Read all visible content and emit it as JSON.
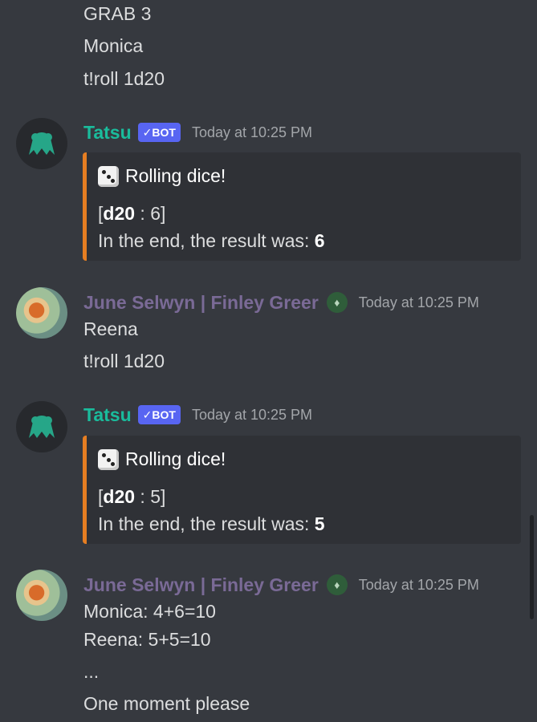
{
  "colors": {
    "background": "#36393f",
    "bot_name": "#1abc9c",
    "user_name": "#7a6a96",
    "bot_tag": "#5865f2",
    "embed_bar": "#e67e22",
    "embed_bg": "#2f3136"
  },
  "previous_lines": [
    "GRAB 3",
    "Monica",
    "t!roll 1d20"
  ],
  "bot_msg_1": {
    "author": "Tatsu",
    "tag": "✓BOT",
    "timestamp": "Today at 10:25 PM",
    "embed": {
      "icon": "dice-icon",
      "title": "Rolling dice!",
      "roll_open": "[",
      "roll_die": "d20",
      "roll_rest": " : 6]",
      "result_prefix": "In the end, the result was: ",
      "result_value": "6"
    }
  },
  "user_msg_1": {
    "author": "June Selwyn | Finley Greer",
    "badge": "slytherin-badge-icon",
    "timestamp": "Today at 10:25 PM",
    "lines": [
      "Reena",
      "t!roll 1d20"
    ]
  },
  "bot_msg_2": {
    "author": "Tatsu",
    "tag": "✓BOT",
    "timestamp": "Today at 10:25 PM",
    "embed": {
      "icon": "dice-icon",
      "title": "Rolling dice!",
      "roll_open": "[",
      "roll_die": "d20",
      "roll_rest": " : 5]",
      "result_prefix": "In the end, the result was: ",
      "result_value": "5"
    }
  },
  "user_msg_2": {
    "author": "June Selwyn | Finley Greer",
    "badge": "slytherin-badge-icon",
    "timestamp": "Today at 10:25 PM",
    "lines": [
      "Monica: 4+6=10",
      "Reena: 5+5=10",
      "...",
      "One moment please"
    ]
  }
}
